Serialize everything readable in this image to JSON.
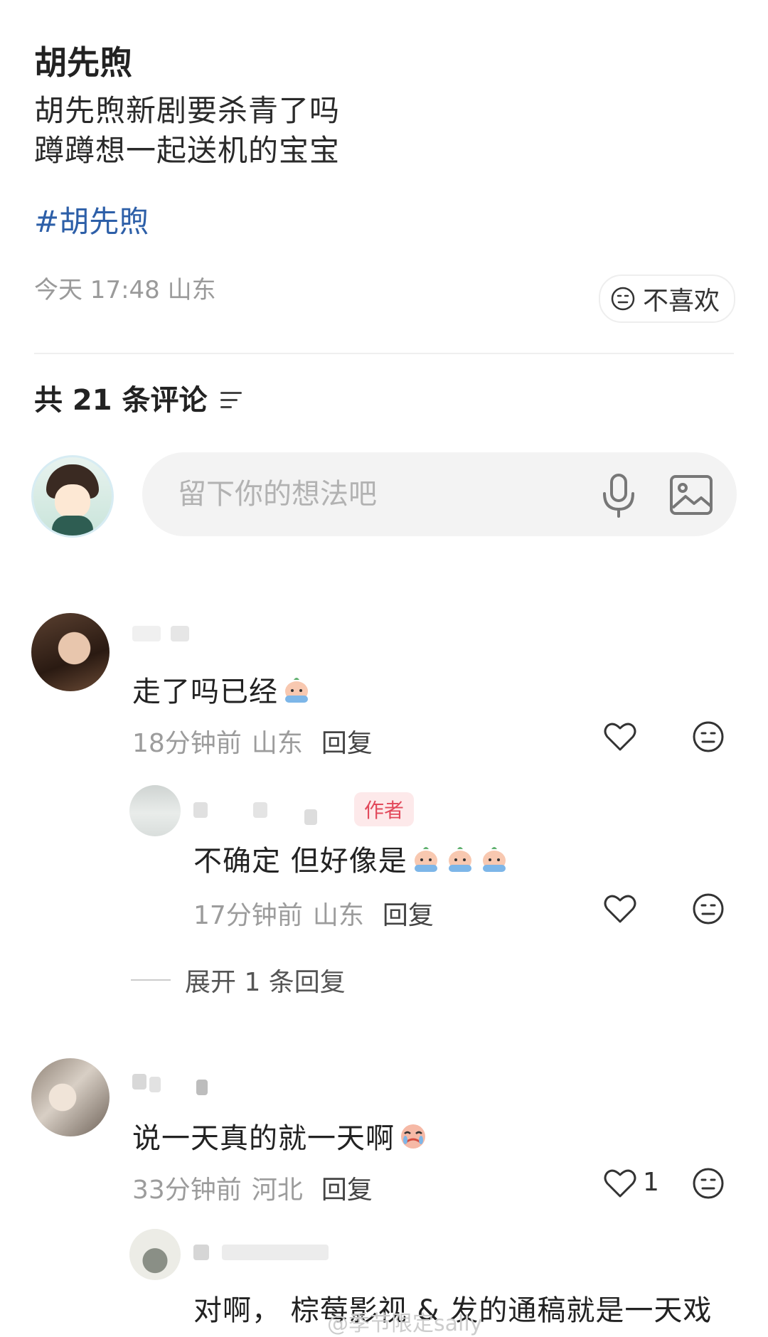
{
  "post": {
    "title": "胡先煦",
    "lines": [
      "胡先煦新剧要杀青了吗",
      "蹲蹲想一起送机的宝宝"
    ],
    "hashtag": "#胡先煦",
    "meta": "今天 17:48 山东",
    "dislike_label": "不喜欢"
  },
  "comments_header": {
    "label": "共 21 条评论"
  },
  "input": {
    "placeholder": "留下你的想法吧"
  },
  "comments": [
    {
      "text": "走了吗已经",
      "time": "18分钟前",
      "location": "山东",
      "reply_label": "回复",
      "likes": "",
      "replies": [
        {
          "author_tag": "作者",
          "text": "不确定 但好像是",
          "time": "17分钟前",
          "location": "山东",
          "reply_label": "回复"
        }
      ],
      "expand_label": "展开 1 条回复"
    },
    {
      "text": "说一天真的就一天啊",
      "time": "33分钟前",
      "location": "河北",
      "reply_label": "回复",
      "likes": "1",
      "replies": [
        {
          "text": "对啊，  棕莓影视 & 发的通稿就是一天戏"
        }
      ]
    }
  ],
  "watermark": "@季节限定sally",
  "colors": {
    "hashtag": "#2d5fa8",
    "author_tag": "#e2495b",
    "muted": "#9c9c9c"
  },
  "icons": [
    "dislike-face-icon",
    "sort-icon",
    "mic-icon",
    "image-icon",
    "heart-icon",
    "neutral-face-icon",
    "crying-emoji-icon"
  ]
}
